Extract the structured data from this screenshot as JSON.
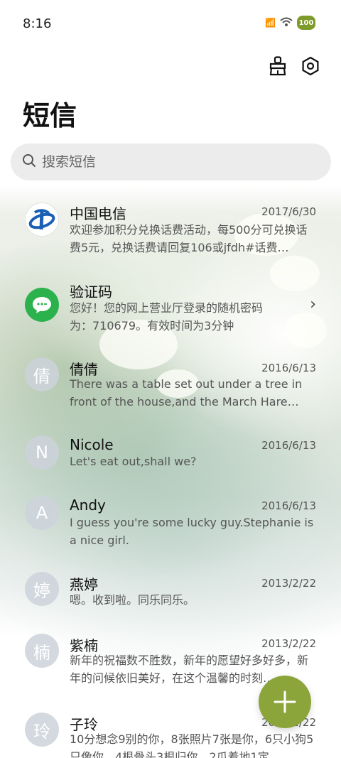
{
  "status_bar": {
    "time": "8:16",
    "battery": "100"
  },
  "title": "短信",
  "search": {
    "placeholder": "搜索短信"
  },
  "conversations": [
    {
      "name": "中国电信",
      "date": "2017/6/30",
      "preview": "欢迎参加积分兑换话费活动，每500分可兑换话费5元，兑换话费请回复106或jfdh#话费…",
      "avatar_icon": "china-telecom-logo-icon"
    },
    {
      "name": "验证码",
      "date": "",
      "preview": "您好！您的网上营业厅登录的随机密码为：710679。有效时间为3分钟",
      "avatar_icon": "message-bubble-icon"
    },
    {
      "name": "倩倩",
      "date": "2016/6/13",
      "preview": "There was a table set out under a tree in front of the house,and the March Hare an…",
      "avatar_letter": "倩"
    },
    {
      "name": "Nicole",
      "date": "2016/6/13",
      "preview": "Let's eat out,shall we?",
      "avatar_letter": "N"
    },
    {
      "name": "Andy",
      "date": "2016/6/13",
      "preview": "I guess you're some lucky guy.Stephanie is a nice girl.",
      "avatar_letter": "A"
    },
    {
      "name": "燕婷",
      "date": "2013/2/22",
      "preview": "嗯。收到啦。同乐同乐。",
      "avatar_letter": "婷"
    },
    {
      "name": "紫楠",
      "date": "2013/2/22",
      "preview": "新年的祝福数不胜数，新年的愿望好多好多，新年的问候依旧美好，在这个温馨的时刻…",
      "avatar_letter": "楠"
    },
    {
      "name": "子玲",
      "date": "2013/2/22",
      "preview": "10分想念9别的你，8张照片7张是你，6只小狗5只像你，4根骨头3根归你，2爪着地1定…",
      "avatar_letter": "玲"
    }
  ],
  "colors": {
    "accent": "#8ba53a",
    "telecom_blue": "#1a5fb4",
    "message_green": "#2bb24c"
  }
}
